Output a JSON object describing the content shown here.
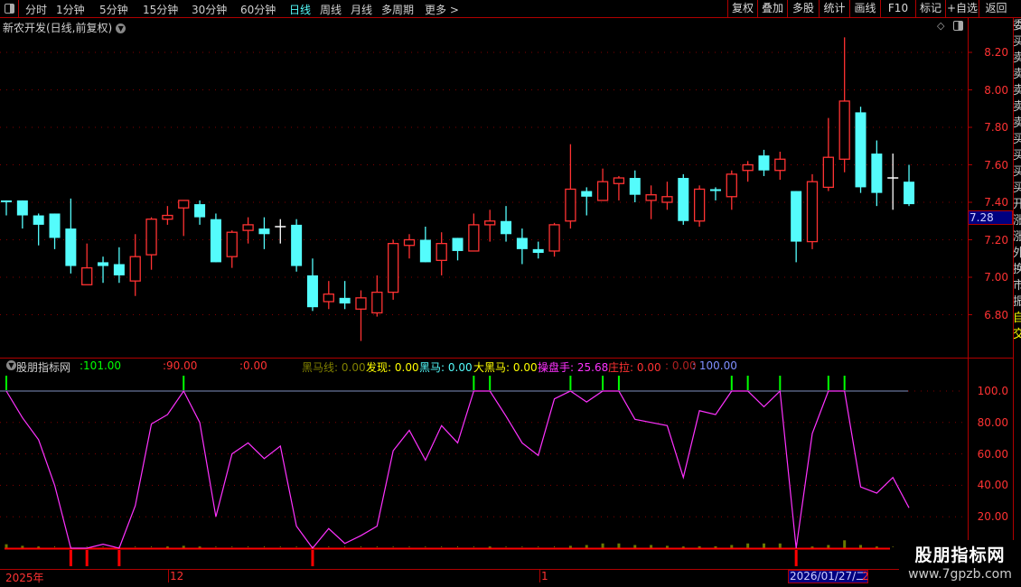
{
  "toolbar": {
    "periods": [
      "分时",
      "1分钟",
      "5分钟",
      "15分钟",
      "30分钟",
      "60分钟",
      "日线",
      "周线",
      "月线",
      "多周期",
      "更多 >"
    ],
    "active_period": "日线",
    "buttons": [
      "复权",
      "叠加",
      "多股",
      "统计",
      "画线",
      "F10",
      "标记",
      "+自选",
      "返回"
    ]
  },
  "chart": {
    "title": "新农开发(日线,前复权)",
    "price_labels": [
      "8.20",
      "8.00",
      "7.80",
      "7.60",
      "7.40",
      "7.20",
      "7.00",
      "6.80"
    ],
    "current_price": "7.28",
    "colors": {
      "up": "#ff3232",
      "down": "#54fcfc",
      "flat": "#ffffff",
      "grid": "#800000"
    }
  },
  "side_strip": [
    "委",
    "买",
    "卖",
    "卖",
    "卖",
    "卖",
    "卖",
    "买",
    "买",
    "买",
    "买",
    "开",
    "涨",
    "涨",
    "外",
    "换",
    "市",
    "振",
    "自",
    "交"
  ],
  "indicator": {
    "name": "股朋指标网",
    "values": [
      {
        "label": "",
        "value": ":101.00",
        "color": "#00ff00"
      },
      {
        "label": "",
        "value": ":90.00",
        "color": "#ff3232"
      },
      {
        "label": "",
        "value": ":0.00",
        "color": "#ff3232"
      },
      {
        "label": "黑马线",
        "value": ": 0.00",
        "color": "#808000"
      },
      {
        "label": "发现",
        "value": ": 0.00",
        "color": "#ffff00"
      },
      {
        "label": "黑马",
        "value": ": 0.00",
        "color": "#54fcfc"
      },
      {
        "label": "大黑马",
        "value": ": 0.00",
        "color": "#ffff00"
      },
      {
        "label": "操盘手",
        "value": ": 25.68",
        "color": "#ff32ff"
      },
      {
        "label": "庄拉",
        "value": ": 0.00",
        "color": "#ff3232"
      },
      {
        "label": "",
        "value": ": 0.00",
        "color": "#b02020"
      },
      {
        "label": "",
        "value": ": 100.00",
        "color": "#8090ff"
      }
    ],
    "axis_labels": [
      "100.0",
      "80.00",
      "60.00",
      "40.00",
      "20.00"
    ]
  },
  "time_axis": {
    "labels": [
      "2025年",
      "12",
      "1",
      "2"
    ],
    "cursor_date": "2026/01/27/二"
  },
  "watermark": {
    "name": "股朋指标网",
    "url": "www.7gpzb.com"
  },
  "chart_data": {
    "type": "candlestick",
    "ylim": [
      6.6,
      8.3
    ],
    "ohlc": [
      [
        7.41,
        7.41,
        7.33,
        7.4
      ],
      [
        7.41,
        7.41,
        7.26,
        7.33
      ],
      [
        7.33,
        7.34,
        7.17,
        7.28
      ],
      [
        7.34,
        7.34,
        7.15,
        7.21
      ],
      [
        7.26,
        7.42,
        7.02,
        7.06
      ],
      [
        6.96,
        7.18,
        6.96,
        7.05
      ],
      [
        7.08,
        7.11,
        6.97,
        7.06
      ],
      [
        7.07,
        7.16,
        6.97,
        7.01
      ],
      [
        6.98,
        7.23,
        6.9,
        7.11
      ],
      [
        7.12,
        7.32,
        7.04,
        7.31
      ],
      [
        7.31,
        7.38,
        7.28,
        7.33
      ],
      [
        7.37,
        7.41,
        7.22,
        7.41
      ],
      [
        7.39,
        7.41,
        7.28,
        7.32
      ],
      [
        7.31,
        7.34,
        7.08,
        7.08
      ],
      [
        7.11,
        7.25,
        7.05,
        7.24
      ],
      [
        7.25,
        7.32,
        7.18,
        7.28
      ],
      [
        7.26,
        7.32,
        7.15,
        7.23
      ],
      [
        7.27,
        7.31,
        7.18,
        7.27
      ],
      [
        7.28,
        7.31,
        7.03,
        7.06
      ],
      [
        7.01,
        7.1,
        6.82,
        6.84
      ],
      [
        6.87,
        6.98,
        6.83,
        6.91
      ],
      [
        6.89,
        6.98,
        6.83,
        6.86
      ],
      [
        6.83,
        6.93,
        6.66,
        6.89
      ],
      [
        6.81,
        7.01,
        6.79,
        6.92
      ],
      [
        6.92,
        7.2,
        6.88,
        7.18
      ],
      [
        7.17,
        7.23,
        7.1,
        7.2
      ],
      [
        7.2,
        7.27,
        7.08,
        7.08
      ],
      [
        7.09,
        7.24,
        7.01,
        7.18
      ],
      [
        7.21,
        7.21,
        7.09,
        7.14
      ],
      [
        7.14,
        7.34,
        7.14,
        7.28
      ],
      [
        7.28,
        7.36,
        7.19,
        7.3
      ],
      [
        7.3,
        7.38,
        7.19,
        7.23
      ],
      [
        7.21,
        7.26,
        7.07,
        7.15
      ],
      [
        7.15,
        7.19,
        7.1,
        7.13
      ],
      [
        7.14,
        7.29,
        7.11,
        7.28
      ],
      [
        7.3,
        7.71,
        7.26,
        7.47
      ],
      [
        7.46,
        7.48,
        7.33,
        7.43
      ],
      [
        7.41,
        7.58,
        7.41,
        7.51
      ],
      [
        7.5,
        7.54,
        7.41,
        7.53
      ],
      [
        7.53,
        7.57,
        7.4,
        7.44
      ],
      [
        7.41,
        7.49,
        7.31,
        7.44
      ],
      [
        7.4,
        7.51,
        7.36,
        7.43
      ],
      [
        7.53,
        7.55,
        7.28,
        7.3
      ],
      [
        7.3,
        7.49,
        7.27,
        7.47
      ],
      [
        7.47,
        7.48,
        7.41,
        7.46
      ],
      [
        7.43,
        7.57,
        7.36,
        7.55
      ],
      [
        7.57,
        7.62,
        7.51,
        7.6
      ],
      [
        7.65,
        7.68,
        7.54,
        7.57
      ],
      [
        7.57,
        7.67,
        7.52,
        7.63
      ],
      [
        7.46,
        7.46,
        7.08,
        7.19
      ],
      [
        7.19,
        7.55,
        7.15,
        7.51
      ],
      [
        7.48,
        7.85,
        7.46,
        7.64
      ],
      [
        7.63,
        8.28,
        7.56,
        7.94
      ],
      [
        7.88,
        7.91,
        7.45,
        7.48
      ],
      [
        7.66,
        7.73,
        7.38,
        7.45
      ],
      [
        7.53,
        7.66,
        7.36,
        7.53
      ],
      [
        7.51,
        7.6,
        7.38,
        7.39
      ]
    ],
    "indicator_line": [
      100,
      83,
      69,
      40,
      0,
      0,
      2.5,
      0,
      27,
      79,
      85,
      100,
      80,
      20,
      60,
      67,
      57,
      65,
      14,
      0,
      12.5,
      3,
      8,
      14,
      62,
      75,
      56,
      78,
      67,
      100,
      100,
      84,
      67,
      59,
      95,
      100,
      93,
      100,
      100,
      82,
      80,
      78,
      45,
      87.5,
      85,
      100,
      100,
      90,
      100,
      0,
      73,
      100,
      100,
      39,
      35,
      45,
      25.68
    ],
    "indicator_ylim": [
      0,
      100
    ],
    "green_signals": [
      0,
      11,
      29,
      30,
      35,
      37,
      38,
      45,
      46,
      48,
      51,
      52
    ],
    "red_signals": [
      4,
      5,
      7,
      19,
      49
    ],
    "olive_bars": {
      "0": 2.5,
      "1": 1.5,
      "2": 1,
      "10": 1,
      "11": 1.5,
      "12": 1,
      "30": 1,
      "35": 1.5,
      "36": 2,
      "37": 3,
      "38": 3,
      "39": 2,
      "40": 2,
      "41": 1.5,
      "42": 1,
      "43": 1.2,
      "44": 1.2,
      "45": 2,
      "46": 3,
      "47": 3,
      "48": 3,
      "50": 1,
      "51": 2,
      "52": 5,
      "53": 2,
      "54": 1
    }
  }
}
